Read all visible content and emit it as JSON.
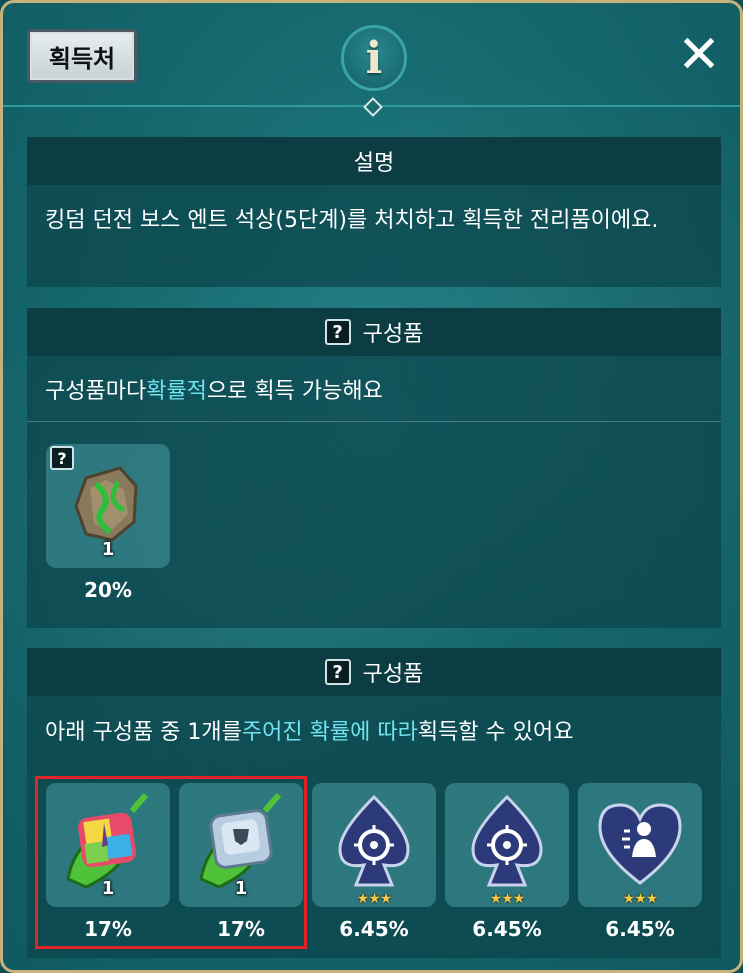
{
  "header": {
    "tag_label": "획득처",
    "info_symbol": "i",
    "close_symbol": "✕"
  },
  "description": {
    "title": "설명",
    "text": "킹덤 던전 보스 엔트 석상(5단계)를 처치하고 획득한 전리품이에요."
  },
  "component_section_1": {
    "title": "구성품",
    "help_symbol": "?",
    "subtitle_pre": "구성품마다 ",
    "subtitle_hl": "확률적",
    "subtitle_post": "으로 획득 가능해요",
    "items": [
      {
        "icon": "ent-stone-icon",
        "qty": "1",
        "percent": "20%",
        "help_symbol": "?"
      }
    ]
  },
  "component_section_2": {
    "title": "구성품",
    "help_symbol": "?",
    "subtitle_pre": "아래 구성품 중 1개를 ",
    "subtitle_hl": "주어진 확률에 따라",
    "subtitle_post": " 획득할 수 있어요",
    "items": [
      {
        "icon": "rainbow-gem-leaf-icon",
        "qty": "1",
        "percent": "17%",
        "stars": ""
      },
      {
        "icon": "silver-gem-leaf-icon",
        "qty": "1",
        "percent": "17%",
        "stars": ""
      },
      {
        "icon": "spade-target-icon",
        "qty": "",
        "percent": "6.45%",
        "stars": "★★★"
      },
      {
        "icon": "spade-target-icon",
        "qty": "",
        "percent": "6.45%",
        "stars": "★★★"
      },
      {
        "icon": "heart-figure-icon",
        "qty": "",
        "percent": "6.45%",
        "stars": "★★★"
      }
    ]
  },
  "colors": {
    "background": "#166a70",
    "highlight_text": "#6fe3ef",
    "selection_border": "#e0242a",
    "star": "#f5c842"
  }
}
